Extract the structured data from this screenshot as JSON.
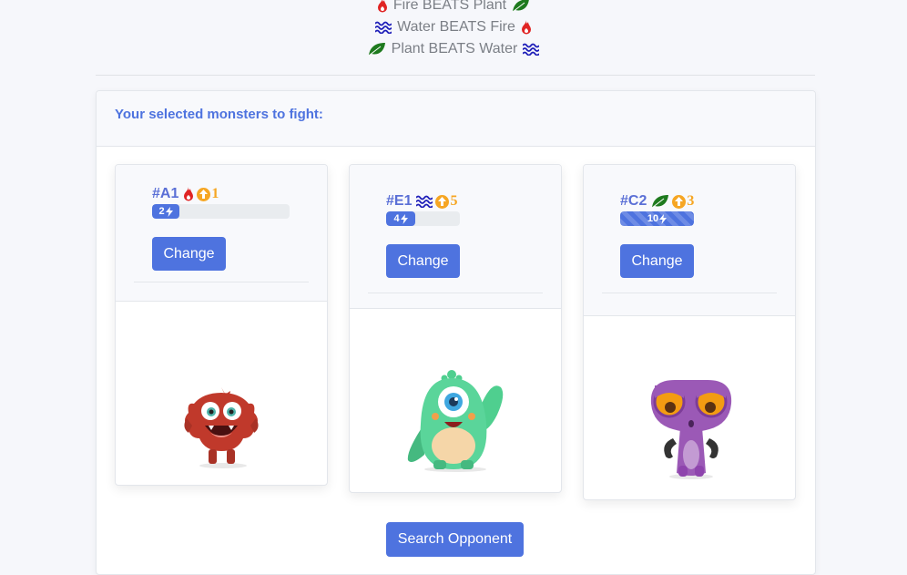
{
  "rules": [
    {
      "left_icon": "fire-icon",
      "text": "Fire BEATS Plant",
      "right_icon": "leaf-icon"
    },
    {
      "left_icon": "water-icon",
      "text": "Water BEATS Fire",
      "right_icon": "fire-icon"
    },
    {
      "left_icon": "leaf-icon",
      "text": "Plant BEATS Water",
      "right_icon": "water-icon"
    }
  ],
  "panel": {
    "title": "Your selected monsters to fight:"
  },
  "monsters": [
    {
      "id": "#A1",
      "element": "fire-icon",
      "level": "1",
      "energy": "2",
      "energy_fraction": 0.2,
      "change_label": "Change",
      "character": "red-furry-monster"
    },
    {
      "id": "#E1",
      "element": "water-icon",
      "level": "5",
      "energy": "4",
      "energy_fraction": 0.4,
      "change_label": "Change",
      "character": "green-cyclops-monster"
    },
    {
      "id": "#C2",
      "element": "leaf-icon",
      "level": "3",
      "energy": "10",
      "energy_fraction": 1.0,
      "change_label": "Change",
      "character": "purple-alien-monster"
    }
  ],
  "search_label": "Search Opponent",
  "colors": {
    "accent": "#4e73df",
    "level": "#f6a623",
    "fire": "#e02424",
    "water": "#1d1db8",
    "plant": "#1e7a1e"
  }
}
